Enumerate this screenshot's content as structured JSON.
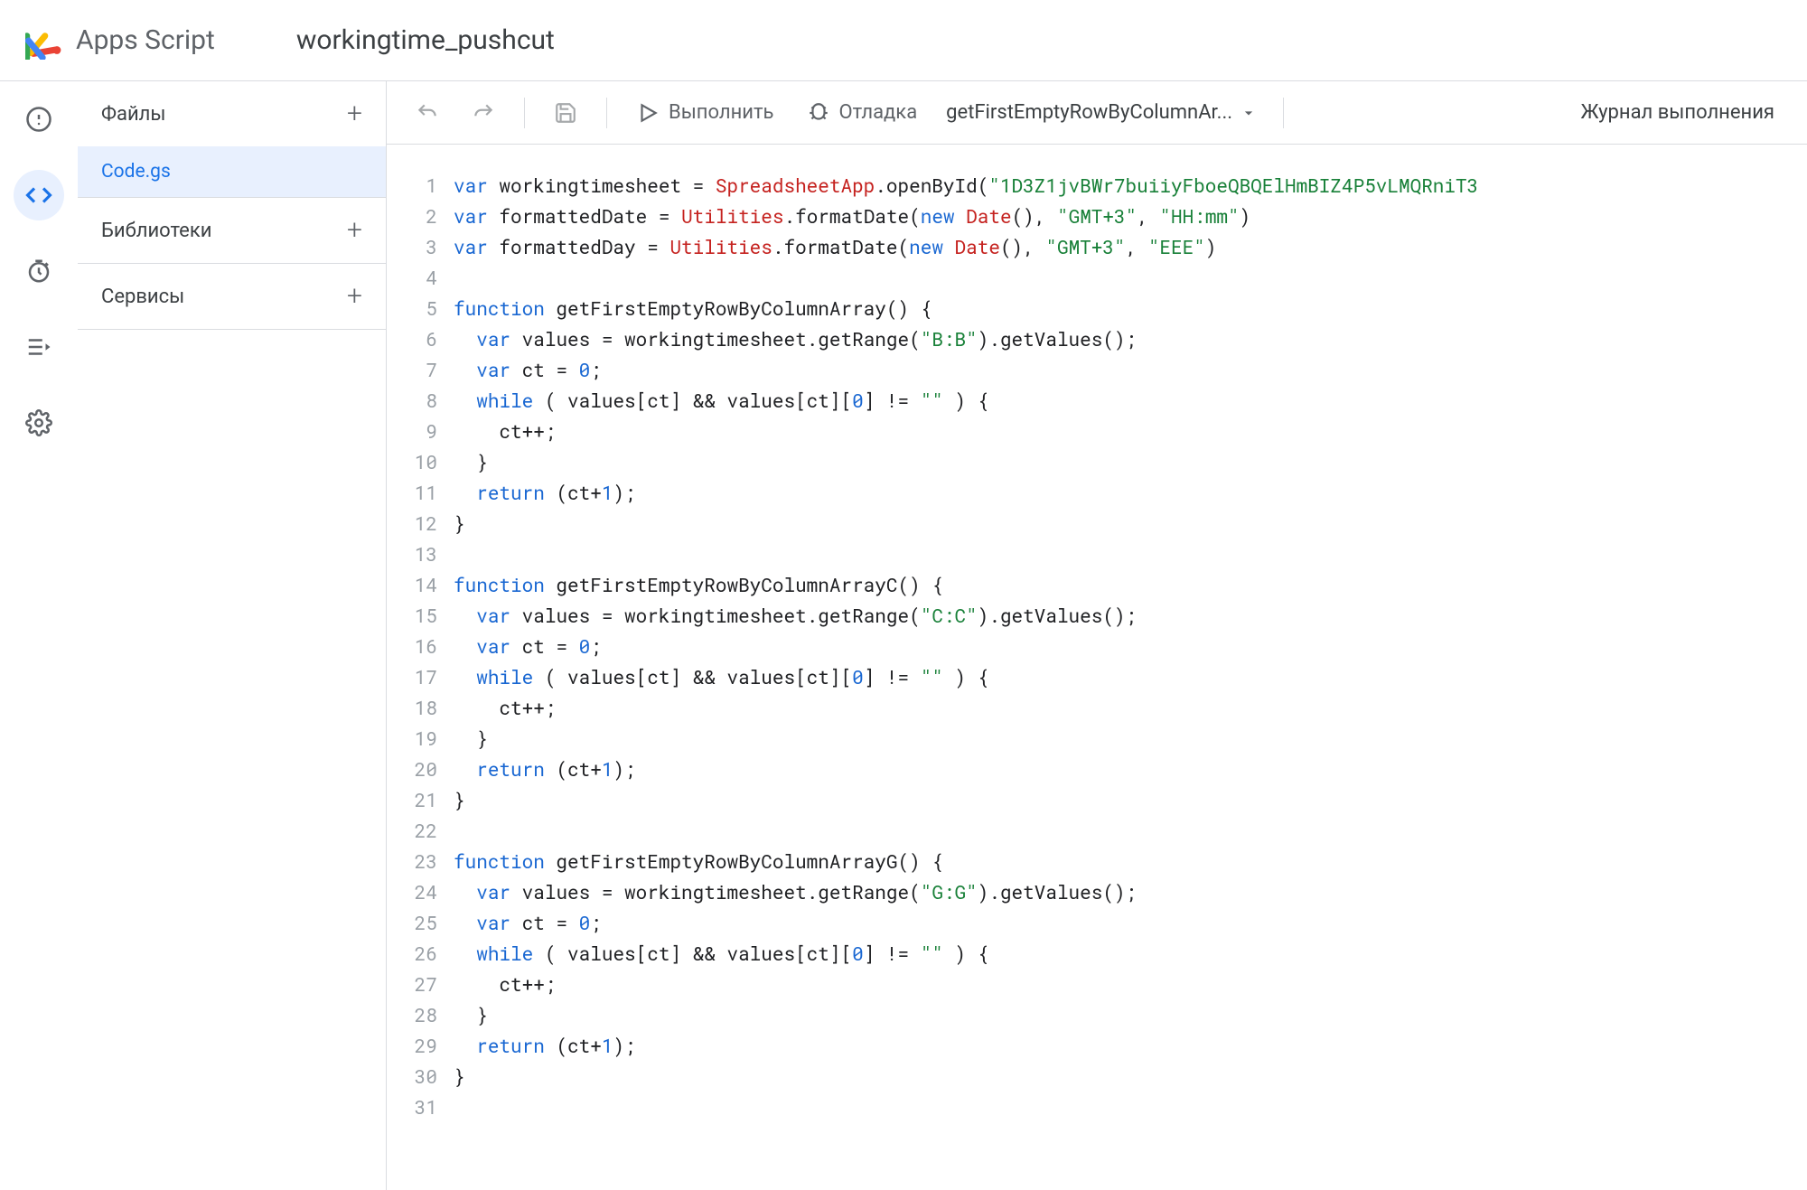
{
  "header": {
    "app_name": "Apps Script",
    "project_name": "workingtime_pushcut"
  },
  "rail": {
    "items": [
      {
        "name": "overview",
        "active": false
      },
      {
        "name": "editor",
        "active": true
      },
      {
        "name": "triggers",
        "active": false
      },
      {
        "name": "executions",
        "active": false
      },
      {
        "name": "settings",
        "active": false
      }
    ]
  },
  "sidebar": {
    "files_label": "Файлы",
    "file_selected": "Code.gs",
    "libraries_label": "Библиотеки",
    "services_label": "Сервисы"
  },
  "toolbar": {
    "run_label": "Выполнить",
    "debug_label": "Отладка",
    "function_selected": "getFirstEmptyRowByColumnAr...",
    "log_label": "Журнал выполнения"
  },
  "code": {
    "line_count": 31,
    "lines": [
      {
        "n": 1,
        "tokens": [
          [
            "kw",
            "var"
          ],
          [
            "",
            " workingtimesheet = "
          ],
          [
            "gl",
            "SpreadsheetApp"
          ],
          [
            "",
            ".openById("
          ],
          [
            "str",
            "\"1D3Z1jvBWr7buiiyFboeQBQElHmBIZ4P5vLMQRniT3"
          ]
        ]
      },
      {
        "n": 2,
        "tokens": [
          [
            "kw",
            "var"
          ],
          [
            "",
            " formattedDate = "
          ],
          [
            "gl",
            "Utilities"
          ],
          [
            "",
            ".formatDate("
          ],
          [
            "kw",
            "new"
          ],
          [
            "",
            " "
          ],
          [
            "gl",
            "Date"
          ],
          [
            "",
            "(), "
          ],
          [
            "str",
            "\"GMT+3\""
          ],
          [
            "",
            ", "
          ],
          [
            "str",
            "\"HH:mm\""
          ],
          [
            "",
            ")"
          ]
        ]
      },
      {
        "n": 3,
        "tokens": [
          [
            "kw",
            "var"
          ],
          [
            "",
            " formattedDay = "
          ],
          [
            "gl",
            "Utilities"
          ],
          [
            "",
            ".formatDate("
          ],
          [
            "kw",
            "new"
          ],
          [
            "",
            " "
          ],
          [
            "gl",
            "Date"
          ],
          [
            "",
            "(), "
          ],
          [
            "str",
            "\"GMT+3\""
          ],
          [
            "",
            ", "
          ],
          [
            "str",
            "\"EEE\""
          ],
          [
            "",
            ")"
          ]
        ]
      },
      {
        "n": 4,
        "tokens": [
          [
            "",
            ""
          ]
        ]
      },
      {
        "n": 5,
        "tokens": [
          [
            "kw",
            "function"
          ],
          [
            "",
            " getFirstEmptyRowByColumnArray() {"
          ]
        ]
      },
      {
        "n": 6,
        "tokens": [
          [
            "",
            "  "
          ],
          [
            "kw",
            "var"
          ],
          [
            "",
            " values = workingtimesheet.getRange("
          ],
          [
            "str",
            "\"B:B\""
          ],
          [
            "",
            ").getValues();"
          ]
        ]
      },
      {
        "n": 7,
        "tokens": [
          [
            "",
            "  "
          ],
          [
            "kw",
            "var"
          ],
          [
            "",
            " ct = "
          ],
          [
            "num",
            "0"
          ],
          [
            "",
            ";"
          ]
        ]
      },
      {
        "n": 8,
        "tokens": [
          [
            "",
            "  "
          ],
          [
            "kw",
            "while"
          ],
          [
            "",
            " ( values[ct] && values[ct]["
          ],
          [
            "num",
            "0"
          ],
          [
            "",
            "] != "
          ],
          [
            "str",
            "\"\""
          ],
          [
            "",
            " ) {"
          ]
        ]
      },
      {
        "n": 9,
        "tokens": [
          [
            "",
            "    ct++;"
          ]
        ]
      },
      {
        "n": 10,
        "tokens": [
          [
            "",
            "  }"
          ]
        ]
      },
      {
        "n": 11,
        "tokens": [
          [
            "",
            "  "
          ],
          [
            "kw",
            "return"
          ],
          [
            "",
            " (ct+"
          ],
          [
            "num",
            "1"
          ],
          [
            "",
            ");"
          ]
        ]
      },
      {
        "n": 12,
        "tokens": [
          [
            "",
            "}"
          ]
        ]
      },
      {
        "n": 13,
        "tokens": [
          [
            "",
            ""
          ]
        ]
      },
      {
        "n": 14,
        "tokens": [
          [
            "kw",
            "function"
          ],
          [
            "",
            " getFirstEmptyRowByColumnArrayC() {"
          ]
        ]
      },
      {
        "n": 15,
        "tokens": [
          [
            "",
            "  "
          ],
          [
            "kw",
            "var"
          ],
          [
            "",
            " values = workingtimesheet.getRange("
          ],
          [
            "str",
            "\"C:C\""
          ],
          [
            "",
            ").getValues();"
          ]
        ]
      },
      {
        "n": 16,
        "tokens": [
          [
            "",
            "  "
          ],
          [
            "kw",
            "var"
          ],
          [
            "",
            " ct = "
          ],
          [
            "num",
            "0"
          ],
          [
            "",
            ";"
          ]
        ]
      },
      {
        "n": 17,
        "tokens": [
          [
            "",
            "  "
          ],
          [
            "kw",
            "while"
          ],
          [
            "",
            " ( values[ct] && values[ct]["
          ],
          [
            "num",
            "0"
          ],
          [
            "",
            "] != "
          ],
          [
            "str",
            "\"\""
          ],
          [
            "",
            " ) {"
          ]
        ]
      },
      {
        "n": 18,
        "tokens": [
          [
            "",
            "    ct++;"
          ]
        ]
      },
      {
        "n": 19,
        "tokens": [
          [
            "",
            "  }"
          ]
        ]
      },
      {
        "n": 20,
        "tokens": [
          [
            "",
            "  "
          ],
          [
            "kw",
            "return"
          ],
          [
            "",
            " (ct+"
          ],
          [
            "num",
            "1"
          ],
          [
            "",
            ");"
          ]
        ]
      },
      {
        "n": 21,
        "tokens": [
          [
            "",
            "}"
          ]
        ]
      },
      {
        "n": 22,
        "tokens": [
          [
            "",
            ""
          ]
        ]
      },
      {
        "n": 23,
        "tokens": [
          [
            "kw",
            "function"
          ],
          [
            "",
            " getFirstEmptyRowByColumnArrayG() {"
          ]
        ]
      },
      {
        "n": 24,
        "tokens": [
          [
            "",
            "  "
          ],
          [
            "kw",
            "var"
          ],
          [
            "",
            " values = workingtimesheet.getRange("
          ],
          [
            "str",
            "\"G:G\""
          ],
          [
            "",
            ").getValues();"
          ]
        ]
      },
      {
        "n": 25,
        "tokens": [
          [
            "",
            "  "
          ],
          [
            "kw",
            "var"
          ],
          [
            "",
            " ct = "
          ],
          [
            "num",
            "0"
          ],
          [
            "",
            ";"
          ]
        ]
      },
      {
        "n": 26,
        "tokens": [
          [
            "",
            "  "
          ],
          [
            "kw",
            "while"
          ],
          [
            "",
            " ( values[ct] && values[ct]["
          ],
          [
            "num",
            "0"
          ],
          [
            "",
            "] != "
          ],
          [
            "str",
            "\"\""
          ],
          [
            "",
            " ) {"
          ]
        ]
      },
      {
        "n": 27,
        "tokens": [
          [
            "",
            "    ct++;"
          ]
        ]
      },
      {
        "n": 28,
        "tokens": [
          [
            "",
            "  }"
          ]
        ]
      },
      {
        "n": 29,
        "tokens": [
          [
            "",
            "  "
          ],
          [
            "kw",
            "return"
          ],
          [
            "",
            " (ct+"
          ],
          [
            "num",
            "1"
          ],
          [
            "",
            ");"
          ]
        ]
      },
      {
        "n": 30,
        "tokens": [
          [
            "",
            "}"
          ]
        ]
      },
      {
        "n": 31,
        "tokens": [
          [
            "",
            ""
          ]
        ]
      }
    ]
  }
}
